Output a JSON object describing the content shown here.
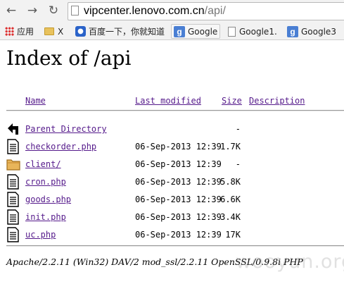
{
  "browser": {
    "address_host": "vipcenter.lenovo.com.cn",
    "address_path": "/api/",
    "back_icon": "arrow-left-icon",
    "forward_icon": "arrow-right-icon",
    "reload_icon": "reload-icon"
  },
  "bookmarks": [
    {
      "label": "应用",
      "icon": "apps-grid-icon"
    },
    {
      "label": "X",
      "icon": "folder-icon"
    },
    {
      "label": "百度一下，你就知道",
      "icon": "baidu-paw-icon"
    },
    {
      "label": "Google",
      "icon": "google-icon"
    },
    {
      "label": "Google1.",
      "icon": "document-icon"
    },
    {
      "label": "Google3",
      "icon": "google-icon"
    }
  ],
  "page": {
    "title": "Index of /api",
    "columns": [
      "Name",
      "Last modified",
      "Size",
      "Description"
    ],
    "entries": [
      {
        "name": "Parent Directory",
        "date": "",
        "size": "-",
        "icon": "back-arrow-icon"
      },
      {
        "name": "checkorder.php",
        "date": "06-Sep-2013 12:39",
        "size": "1.7K",
        "icon": "file-icon"
      },
      {
        "name": "client/",
        "date": "06-Sep-2013 12:39",
        "size": "-",
        "icon": "folder-icon"
      },
      {
        "name": "cron.php",
        "date": "06-Sep-2013 12:39",
        "size": "5.8K",
        "icon": "file-icon"
      },
      {
        "name": "goods.php",
        "date": "06-Sep-2013 12:39",
        "size": "6.6K",
        "icon": "file-icon"
      },
      {
        "name": "init.php",
        "date": "06-Sep-2013 12:39",
        "size": "3.4K",
        "icon": "file-icon"
      },
      {
        "name": "uc.php",
        "date": "06-Sep-2013 12:39",
        "size": "17K",
        "icon": "file-icon"
      }
    ],
    "footer": "Apache/2.2.11 (Win32) DAV/2 mod_ssl/2.2.11 OpenSSL/0.9.8i PHP",
    "watermark": "wooyun.org"
  }
}
